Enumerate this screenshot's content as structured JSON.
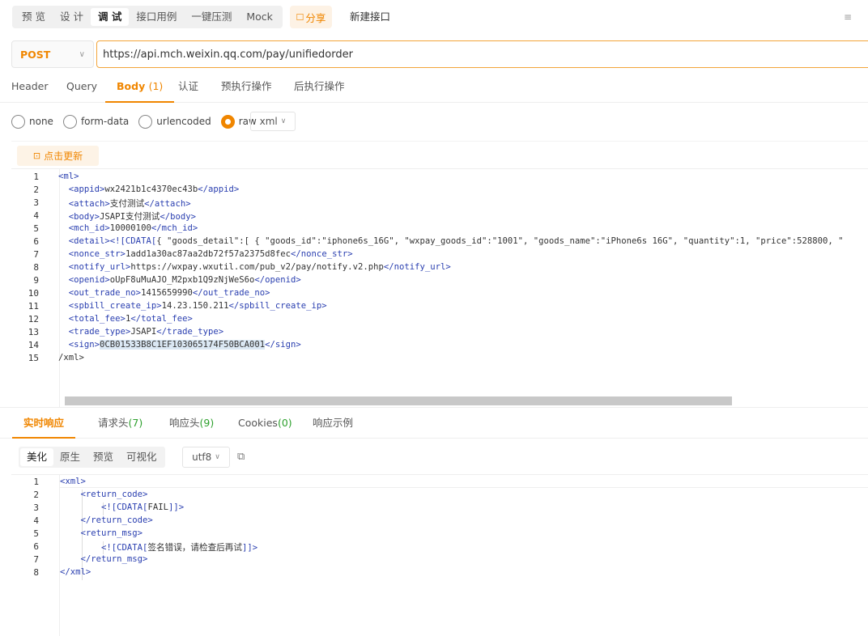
{
  "mode_tabs": [
    "预 览",
    "设 计",
    "调 试",
    "接口用例",
    "一键压测",
    "Mock"
  ],
  "share_label": "分享",
  "new_interface": "新建接口",
  "method": "POST",
  "url": "https://api.mch.weixin.qq.com/pay/unifiedorder",
  "req_tabs": {
    "header": "Header",
    "query": "Query",
    "body": "Body",
    "body_count": "(1)",
    "auth": "认证",
    "pre": "预执行操作",
    "post": "后执行操作"
  },
  "body_types": [
    "none",
    "form-data",
    "urlencoded",
    "raw"
  ],
  "body_format": "xml",
  "update_label": "点击更新",
  "request_code": [
    {
      "n": "1",
      "t": "<ml>"
    },
    {
      "n": "2",
      "t": "  <appid>wx2421b1c4370ec43b</appid>"
    },
    {
      "n": "3",
      "t": "  <attach>支付测试</attach>"
    },
    {
      "n": "4",
      "t": "  <body>JSAPI支付测试</body>"
    },
    {
      "n": "5",
      "t": "  <mch_id>10000100</mch_id>"
    },
    {
      "n": "6",
      "t": "  <detail><![CDATA[{ \"goods_detail\":[ { \"goods_id\":\"iphone6s_16G\", \"wxpay_goods_id\":\"1001\", \"goods_name\":\"iPhone6s 16G\", \"quantity\":1, \"price\":528800, \""
    },
    {
      "n": "7",
      "t": "  <nonce_str>1add1a30ac87aa2db72f57a2375d8fec</nonce_str>"
    },
    {
      "n": "8",
      "t": "  <notify_url>https://wxpay.wxutil.com/pub_v2/pay/notify.v2.php</notify_url>"
    },
    {
      "n": "9",
      "t": "  <openid>oUpF8uMuAJO_M2pxb1Q9zNjWeS6o</openid>"
    },
    {
      "n": "10",
      "t": "  <out_trade_no>1415659990</out_trade_no>"
    },
    {
      "n": "11",
      "t": "  <spbill_create_ip>14.23.150.211</spbill_create_ip>"
    },
    {
      "n": "12",
      "t": "  <total_fee>1</total_fee>"
    },
    {
      "n": "13",
      "t": "  <trade_type>JSAPI</trade_type>"
    },
    {
      "n": "14",
      "t": "  <sign>0CB01533B8C1EF103065174F50BCA001</sign>"
    },
    {
      "n": "15",
      "t": "/xml>"
    }
  ],
  "resp_tabs": {
    "live": "实时响应",
    "req_headers": "请求头",
    "req_headers_count": "(7)",
    "resp_headers": "响应头",
    "resp_headers_count": "(9)",
    "cookies": "Cookies",
    "cookies_count": "(0)",
    "example": "响应示例"
  },
  "view_tabs": [
    "美化",
    "原生",
    "预览",
    "可视化"
  ],
  "encoding": "utf8",
  "response_code": [
    {
      "n": "1",
      "t": "<xml>"
    },
    {
      "n": "2",
      "t": "    <return_code>"
    },
    {
      "n": "3",
      "t": "        <![CDATA[FAIL]]>"
    },
    {
      "n": "4",
      "t": "    </return_code>"
    },
    {
      "n": "5",
      "t": "    <return_msg>"
    },
    {
      "n": "6",
      "t": "        <![CDATA[签名错误，请检查后再试]]>"
    },
    {
      "n": "7",
      "t": "    </return_msg>"
    },
    {
      "n": "8",
      "t": "</xml>"
    }
  ],
  "colors": {
    "accent": "#f08600",
    "tag": "#2a3fb0",
    "count_green": "#2ea02e"
  }
}
